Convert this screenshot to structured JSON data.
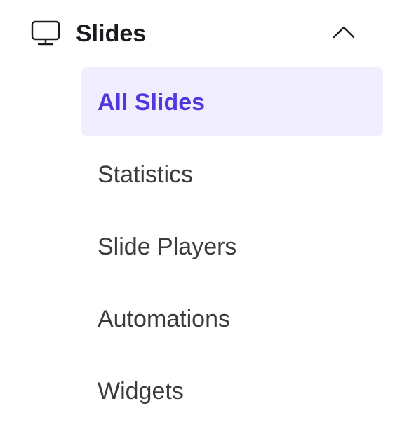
{
  "nav": {
    "group": {
      "title": "Slides",
      "icon": "monitor-icon",
      "expanded": true,
      "toggle_icon": "chevron-up-icon"
    },
    "items": [
      {
        "label": "All Slides",
        "active": true
      },
      {
        "label": "Statistics",
        "active": false
      },
      {
        "label": "Slide Players",
        "active": false
      },
      {
        "label": "Automations",
        "active": false
      },
      {
        "label": "Widgets",
        "active": false
      }
    ]
  },
  "colors": {
    "active_background": "#efedfe",
    "active_text": "#4f39dd",
    "text": "#3a3a3f",
    "title": "#1b1b1f"
  }
}
